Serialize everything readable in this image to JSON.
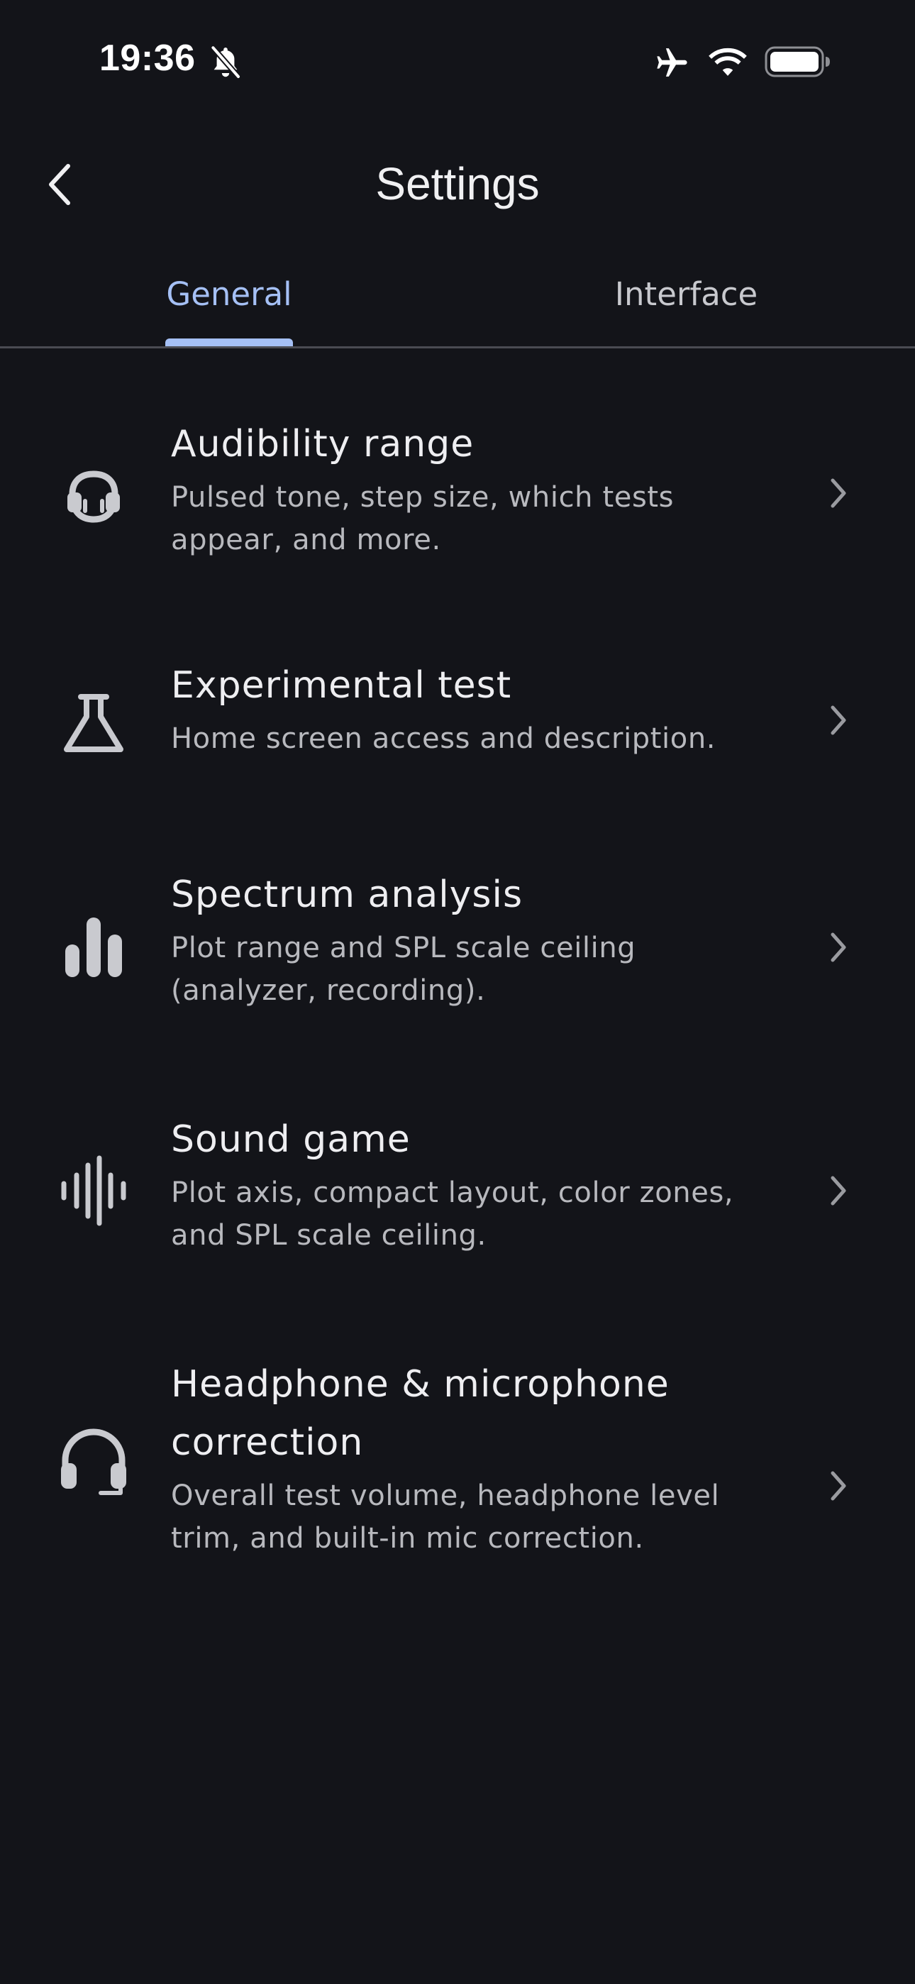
{
  "status_bar": {
    "time": "19:36",
    "icons": [
      "bell-slash-icon",
      "airplane-icon",
      "wifi-icon",
      "battery-icon"
    ]
  },
  "header": {
    "back_icon": "chevron-left-icon",
    "title": "Settings"
  },
  "tabs": [
    {
      "label": "General",
      "active": true
    },
    {
      "label": "Interface",
      "active": false
    }
  ],
  "settings": [
    {
      "icon": "audibility-range-icon",
      "title": "Audibility range",
      "description_lines": [
        "Pulsed tone, step size, which tests",
        "appear, and more."
      ]
    },
    {
      "icon": "flask-icon",
      "title": "Experimental test",
      "description_lines": [
        "Home screen access and description."
      ]
    },
    {
      "icon": "bar-chart-icon",
      "title": "Spectrum analysis",
      "description_lines": [
        "Plot range and SPL scale ceiling",
        "(analyzer, recording)."
      ]
    },
    {
      "icon": "waveform-icon",
      "title": "Sound game",
      "description_lines": [
        "Plot axis, compact layout, color zones,",
        "and SPL scale ceiling."
      ]
    },
    {
      "icon": "headset-icon",
      "title_lines": [
        "Headphone & microphone",
        "correction"
      ],
      "description_lines": [
        "Overall test volume, headphone level",
        "trim, and built-in mic correction."
      ]
    }
  ],
  "colors": {
    "background": "#131419",
    "accent": "#a5c0f5",
    "primary_text": "#eeeef1",
    "secondary_text": "#b8b9be",
    "divider": "#4a4b52"
  }
}
